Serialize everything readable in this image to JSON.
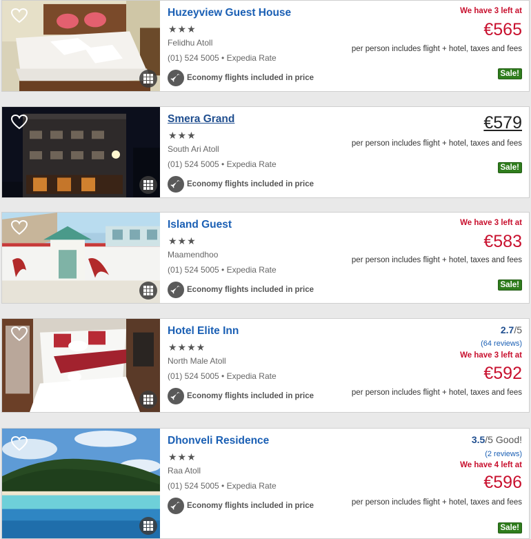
{
  "listings": [
    {
      "name": "Huzeyview Guest House",
      "stars": "★★★",
      "location": "Felidhu Atoll",
      "phone": "(01) 524 5005 • Expedia Rate",
      "flights": "Economy flights included in price",
      "alert": "We have 3 left at",
      "price": "€565",
      "per_person": "per person includes flight + hotel, taxes and fees",
      "sale": "Sale!"
    },
    {
      "name": "Smera Grand",
      "stars": "★★★",
      "location": "South Ari Atoll",
      "phone": "(01) 524 5005 • Expedia Rate",
      "flights": "Economy flights included in price",
      "price": "€579",
      "per_person": "per person includes flight + hotel, taxes and fees",
      "sale": "Sale!"
    },
    {
      "name": "Island Guest",
      "stars": "★★★",
      "location": "Maamendhoo",
      "phone": "(01) 524 5005 • Expedia Rate",
      "flights": "Economy flights included in price",
      "alert": "We have 3 left at",
      "price": "€583",
      "per_person": "per person includes flight + hotel, taxes and fees",
      "sale": "Sale!"
    },
    {
      "name": "Hotel Elite Inn",
      "stars": "★★★★",
      "location": "North Male Atoll",
      "phone": "(01) 524 5005 • Expedia Rate",
      "flights": "Economy flights included in price",
      "rating_score": "2.7",
      "rating_suffix": "/5",
      "reviews": "(64 reviews)",
      "alert": "We have 3 left at",
      "price": "€592",
      "per_person": "per person includes flight + hotel, taxes and fees"
    },
    {
      "name": "Dhonveli Residence",
      "stars": "★★★",
      "location": "Raa Atoll",
      "phone": "(01) 524 5005 • Expedia Rate",
      "flights": "Economy flights included in price",
      "rating_score": "3.5",
      "rating_suffix": "/5 Good!",
      "reviews": "(2 reviews)",
      "alert": "We have 4 left at",
      "price": "€596",
      "per_person": "per person includes flight + hotel, taxes and fees",
      "sale": "Sale!"
    }
  ],
  "icons": {
    "favorite": "heart-icon",
    "gallery": "grid-icon",
    "flight": "airplane-icon"
  },
  "colors": {
    "link": "#1a5fb4",
    "price": "#c8102e",
    "sale": "#2f7d1d"
  }
}
